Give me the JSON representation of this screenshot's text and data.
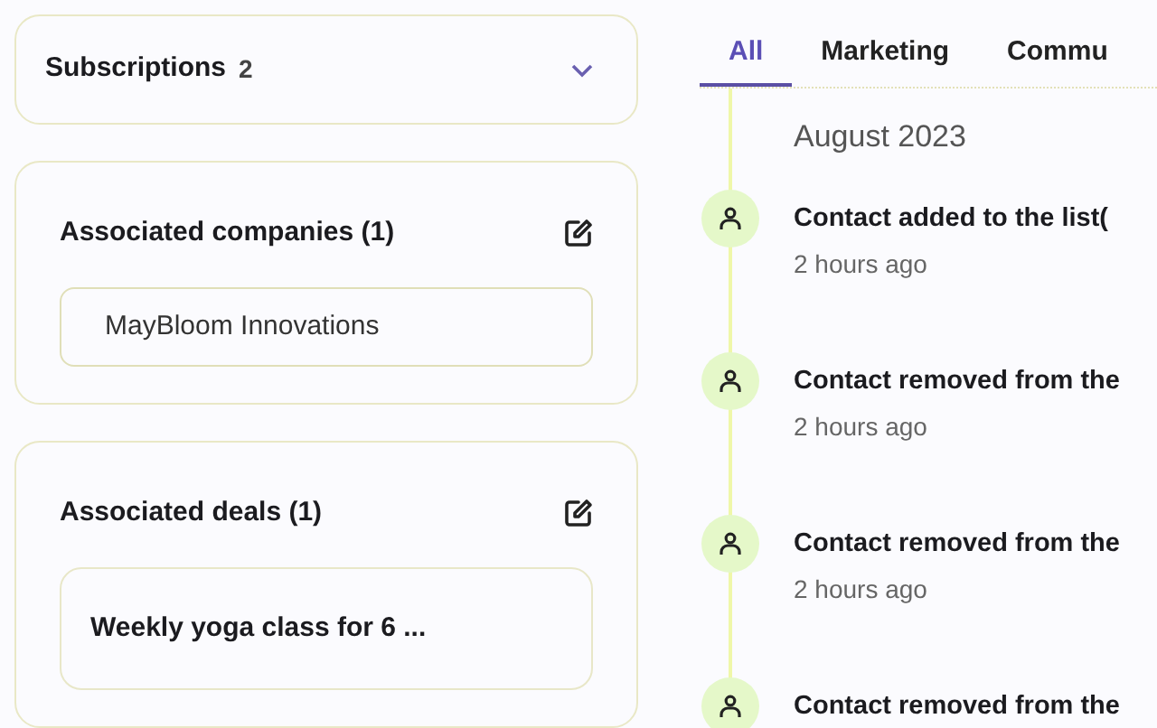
{
  "subscriptions": {
    "title": "Subscriptions",
    "count": "2",
    "expanded": false
  },
  "companies": {
    "title": "Associated companies (1)",
    "items": [
      "MayBloom Innovations"
    ]
  },
  "deals": {
    "title": "Associated deals (1)",
    "items": [
      "Weekly yoga class for 6 ..."
    ]
  },
  "tabs": [
    {
      "label": "All",
      "selected": true
    },
    {
      "label": "Marketing",
      "selected": false
    },
    {
      "label": "Commu",
      "selected": false
    }
  ],
  "timeline": {
    "month": "August 2023",
    "events": [
      {
        "title": "Contact added to the list(",
        "time": "2 hours ago"
      },
      {
        "title": "Contact removed from the",
        "time": "2 hours ago"
      },
      {
        "title": "Contact removed from the",
        "time": "2 hours ago"
      },
      {
        "title": "Contact removed from the"
      }
    ]
  }
}
